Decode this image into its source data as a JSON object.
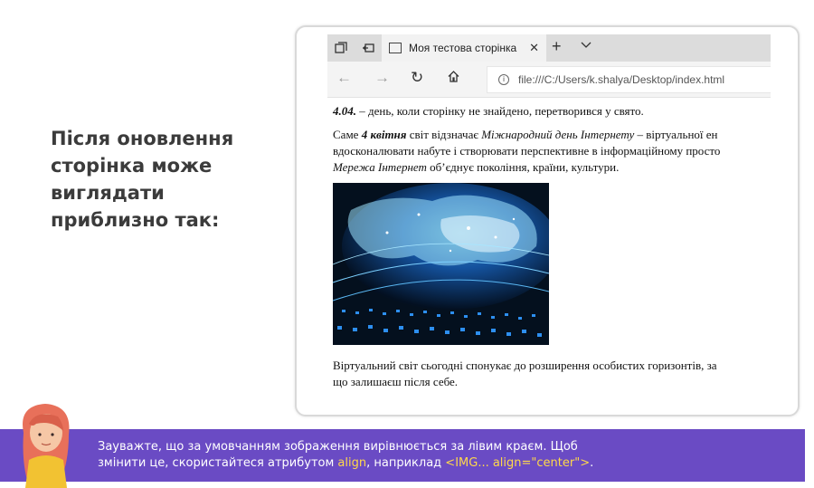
{
  "slide": {
    "heading": "Після оновлення сторінка може виглядати приблизно так:"
  },
  "browser": {
    "tab_title": "Моя тестова сторінка",
    "url": "file:///C:/Users/k.shalya/Desktop/index.html"
  },
  "page": {
    "p1_bold": "4.04.",
    "p1_rest": " – день, коли сторінку не знайдено, перетворився у свято.",
    "p2_a": "Саме ",
    "p2_bold": "4 квітня",
    "p2_b": " світ відзначає ",
    "p2_italic": "Міжнародний день Інтернету",
    "p2_c": " – віртуальної ен",
    "p2_line2": "вдосконалювати набуте і створювати перспективне в інформаційному просто",
    "p2_italic2": "Мережа Інтернет",
    "p2_line3": " об’єднує покоління, країни, культури.",
    "p3_line1": "Віртуальний світ сьогодні спонукає до розширення особистих горизонтів, за",
    "p3_line2": "що залишаєш після себе."
  },
  "note": {
    "line1": "Зауважте, що за умовчанням зображення вирівнюється за лівим краєм. Щоб",
    "line2_a": "змінити це, скористайтеся атрибутом ",
    "highlight1": "align",
    "line2_b": ", наприклад ",
    "highlight2": "<IMG... align=\"center\">",
    "line2_c": "."
  },
  "colors": {
    "accent_bar": "#6a4bc4",
    "highlight": "#ffd84a"
  }
}
